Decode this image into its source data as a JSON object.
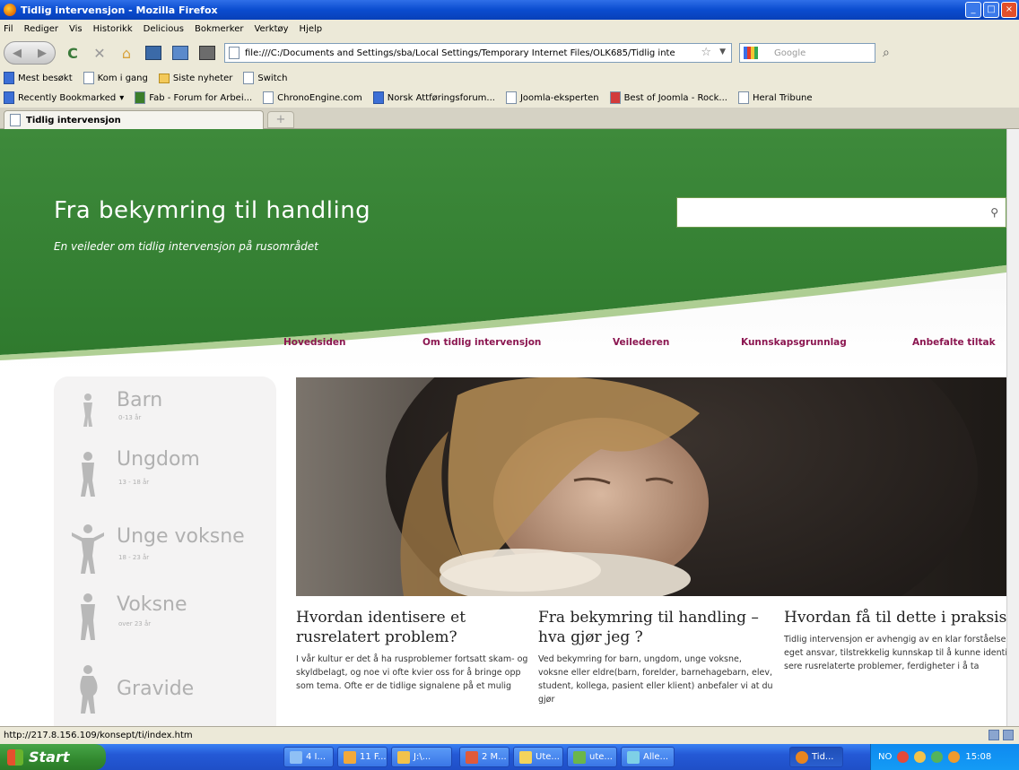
{
  "window": {
    "title": "Tidlig intervensjon - Mozilla Firefox"
  },
  "menu": [
    "Fil",
    "Rediger",
    "Vis",
    "Historikk",
    "Delicious",
    "Bokmerker",
    "Verktøy",
    "Hjelp"
  ],
  "nav": {
    "url": "file:///C:/Documents and Settings/sba/Local Settings/Temporary Internet Files/OLK685/Tidlig inte",
    "search_placeholder": "Google"
  },
  "bookmarks1": [
    "Mest besøkt",
    "Kom i gang",
    "Siste nyheter",
    "Switch"
  ],
  "bookmarks2": [
    "Recently Bookmarked",
    "Fab - Forum for Arbei...",
    "ChronoEngine.com",
    "Norsk Attføringsforum...",
    "Joomla-eksperten",
    "Best of Joomla - Rock...",
    "Heral Tribune"
  ],
  "tab": {
    "label": "Tidlig intervensjon",
    "new_tab": "+"
  },
  "site": {
    "title": "Fra bekymring til handling",
    "subtitle": "En veileder om tidlig intervensjon på rusområdet",
    "nav": [
      "Hovedsiden",
      "Om tidlig intervensjon",
      "Veilederen",
      "Kunnskapsgrunnlag",
      "Anbefalte tiltak"
    ],
    "groups": [
      {
        "label": "Barn",
        "sub": "0-13 år"
      },
      {
        "label": "Ungdom",
        "sub": "13 - 18 år"
      },
      {
        "label": "Unge voksne",
        "sub": "18 - 23 år"
      },
      {
        "label": "Voksne",
        "sub": "over 23 år"
      },
      {
        "label": "Gravide",
        "sub": ""
      }
    ],
    "columns": [
      {
        "title": "Hvordan identisere et rusrelatert problem?",
        "text": "I vår kultur er det å ha rusproblemer fortsatt skam- og skyldbelagt, og noe vi ofte kvier oss for å bringe opp som tema. Ofte er de tidlige signalene på et mulig"
      },
      {
        "title": "Fra bekymring til handling – hva gjør jeg ?",
        "text": "Ved bekymring for barn, ungdom, unge voksne, voksne eller eldre(barn, forelder, barnehagebarn, elev, student, kollega, pasient eller klient) anbefaler vi at du gjør"
      },
      {
        "title": "Hvordan få til dette i praksis?",
        "text": "Tidlig intervensjon er avhengig av en klar forståelse av eget ansvar, tilstrekkelig kunnskap til å kunne identifi sere rusrelaterte problemer, ferdigheter i å ta"
      }
    ]
  },
  "status": {
    "text": "http://217.8.156.109/konsept/ti/index.htm"
  },
  "taskbar": {
    "start": "Start",
    "buttons": [
      "4 I...",
      "11 F...",
      "J:\\...",
      "2 M...",
      "Ute...",
      "ute...",
      "Alle...",
      "Tid..."
    ],
    "tray_label": "NO",
    "clock": "15:08"
  },
  "colors": {
    "green": "#3e8a3b",
    "nav_text": "#8b1650"
  }
}
